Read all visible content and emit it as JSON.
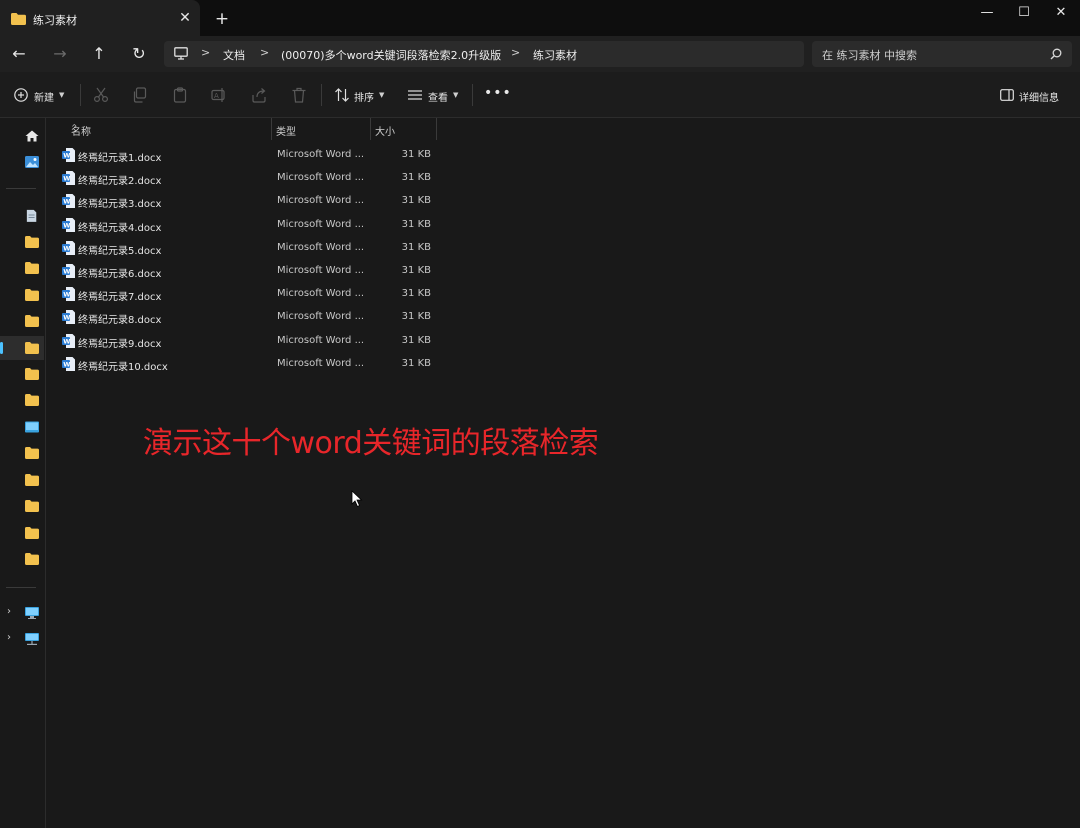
{
  "window": {
    "tab_title": "练习素材",
    "tab_close": "✕",
    "new_tab": "+",
    "minimize": "—",
    "maximize": "☐",
    "close": "✕"
  },
  "nav": {
    "back": "←",
    "forward": "→",
    "up": "↑",
    "refresh": "↻"
  },
  "address": {
    "crumbs": [
      "文档",
      "(00070)多个word关键词段落检索2.0升级版",
      "练习素材"
    ],
    "separator": ">"
  },
  "search": {
    "placeholder": "在 练习素材 中搜索"
  },
  "command_bar": {
    "new_label": "新建",
    "sort_label": "排序",
    "view_label": "查看",
    "more_label": "•••",
    "details_label": "详细信息"
  },
  "columns": {
    "name": "名称",
    "type": "类型",
    "size": "大小"
  },
  "files": [
    {
      "name": "终焉纪元录1.docx",
      "type": "Microsoft Word ...",
      "size": "31 KB"
    },
    {
      "name": "终焉纪元录2.docx",
      "type": "Microsoft Word ...",
      "size": "31 KB"
    },
    {
      "name": "终焉纪元录3.docx",
      "type": "Microsoft Word ...",
      "size": "31 KB"
    },
    {
      "name": "终焉纪元录4.docx",
      "type": "Microsoft Word ...",
      "size": "31 KB"
    },
    {
      "name": "终焉纪元录5.docx",
      "type": "Microsoft Word ...",
      "size": "31 KB"
    },
    {
      "name": "终焉纪元录6.docx",
      "type": "Microsoft Word ...",
      "size": "31 KB"
    },
    {
      "name": "终焉纪元录7.docx",
      "type": "Microsoft Word ...",
      "size": "31 KB"
    },
    {
      "name": "终焉纪元录8.docx",
      "type": "Microsoft Word ...",
      "size": "31 KB"
    },
    {
      "name": "终焉纪元录9.docx",
      "type": "Microsoft Word ...",
      "size": "31 KB"
    },
    {
      "name": "终焉纪元录10.docx",
      "type": "Microsoft Word ...",
      "size": "31 KB"
    }
  ],
  "overlay": {
    "caption": "演示这十个word关键词的段落检索"
  },
  "colors": {
    "accent": "#4cc2ff",
    "caption": "#e8262a",
    "folder": "#f2c14e",
    "word_icon": "#2b7cd3"
  }
}
